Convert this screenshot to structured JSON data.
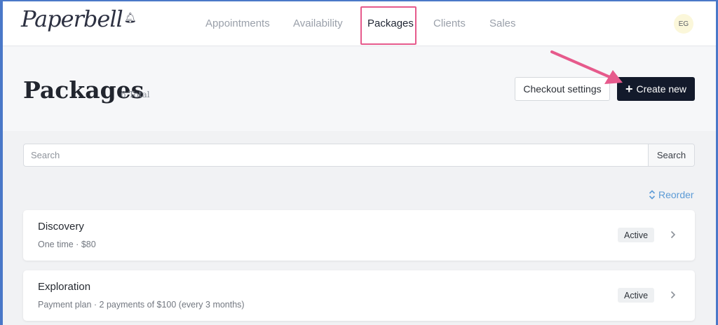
{
  "app": {
    "logo_text": "Paperbell",
    "logo_icon": "bell-icon"
  },
  "nav": {
    "items": [
      {
        "label": "Appointments"
      },
      {
        "label": "Availability"
      },
      {
        "label": "Packages"
      },
      {
        "label": "Clients"
      },
      {
        "label": "Sales"
      }
    ],
    "active": "Packages",
    "avatar_initials": "EG"
  },
  "header": {
    "title": "Packages",
    "total": "6 Total",
    "checkout_settings_label": "Checkout settings",
    "create_new_label": "Create new"
  },
  "search": {
    "placeholder": "Search",
    "button_label": "Search"
  },
  "reorder_label": "Reorder",
  "packages": [
    {
      "name": "Discovery",
      "detail": "One time · $80",
      "status": "Active"
    },
    {
      "name": "Exploration",
      "detail": "Payment plan · 2 payments of $100 (every 3 months)",
      "status": "Active"
    }
  ],
  "colors": {
    "annotation": "#e65a8c",
    "primary_button": "#131a2b",
    "link": "#5c9bd6"
  }
}
